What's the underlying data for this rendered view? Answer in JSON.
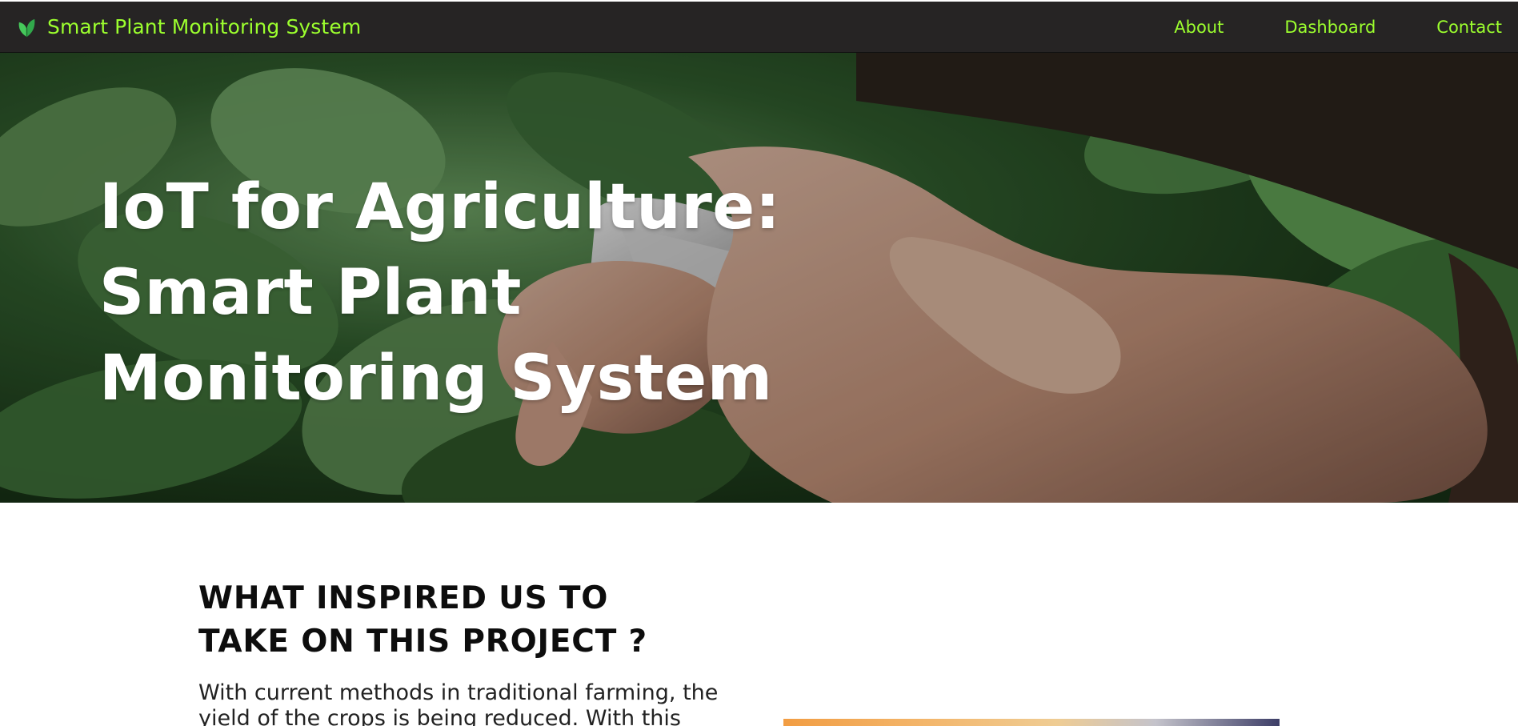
{
  "navbar": {
    "brand_title": "Smart Plant Monitoring System",
    "brand_icon": "leaf-icon",
    "links": [
      "About",
      "Dashboard",
      "Contact"
    ]
  },
  "hero": {
    "title": "IoT for Agriculture: Smart Plant Monitoring System",
    "background_image": "hands-holding-smartphone-in-green-crop-field"
  },
  "section": {
    "title": "WHAT INSPIRED US TO TAKE ON THIS PROJECT ?",
    "text": "With current methods in traditional farming, the yield of the crops is being reduced. With this IOT"
  },
  "colors": {
    "nav_background": "#262424",
    "accent_green": "#9cff2e",
    "hero_text": "#ffffff"
  }
}
